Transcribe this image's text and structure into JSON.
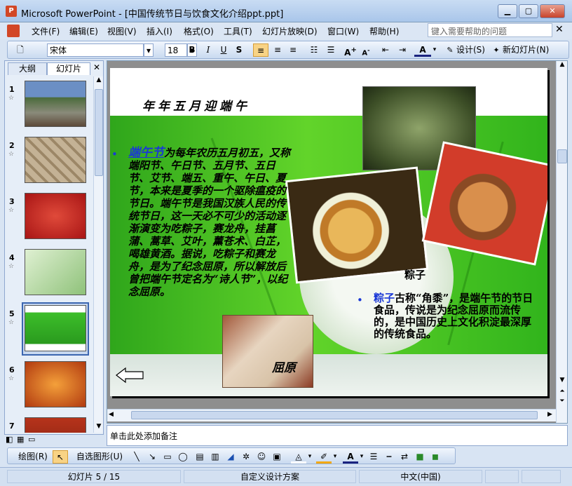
{
  "window": {
    "title": "Microsoft PowerPoint - [中国传统节日与饮食文化介绍ppt.ppt]",
    "app_icon": "P"
  },
  "menu": {
    "items": [
      "文件(F)",
      "编辑(E)",
      "视图(V)",
      "插入(I)",
      "格式(O)",
      "工具(T)",
      "幻灯片放映(D)",
      "窗口(W)",
      "帮助(H)"
    ],
    "help_placeholder": "键入需要帮助的问题"
  },
  "toolbar": {
    "font": "宋体",
    "size": "18",
    "bold": "B",
    "italic": "I",
    "underline": "U",
    "shadow": "S",
    "design": "设计(S)",
    "new_slide": "新幻灯片(N)"
  },
  "panel": {
    "tab_outline": "大纲",
    "tab_slides": "幻灯片",
    "thumbs": [
      {
        "num": "1"
      },
      {
        "num": "2"
      },
      {
        "num": "3"
      },
      {
        "num": "4"
      },
      {
        "num": "5"
      },
      {
        "num": "6"
      },
      {
        "num": "7"
      }
    ],
    "selected": 5
  },
  "slide": {
    "heading": "年年五月迎端午",
    "bullet1_term": "端午节",
    "bullet1_text": "为每年农历五月初五，又称端阳节、午日节、五月节、五日节、艾节、端五、重午、午日、夏节，本来是夏季的一个驱除瘟疫的节日。端午节是我国汉族人民的传统节日，这一天必不可少的活动逐渐演变为吃粽子，赛龙舟，挂菖蒲、蒿草、艾叶，薰苍术、白芷，喝雄黄酒。据说，吃粽子和赛龙舟，是为了纪念屈原，所以解放后曾把端午节定名为“诗人节”，以纪念屈原。",
    "caption": "粽子",
    "bullet2_term": "粽子",
    "bullet2_text": "古称“角黍”，是端午节的节日食品，传说是为纪念屈原而流传的，是中国历史上文化积淀最深厚的传统食品。",
    "painting_label": "屈原"
  },
  "notes": {
    "placeholder": "单击此处添加备注"
  },
  "drawbar": {
    "draw": "绘图(R)",
    "autoshapes": "自选图形(U)"
  },
  "status": {
    "slide": "幻灯片 5 / 15",
    "design": "自定义设计方案",
    "lang": "中文(中国)"
  }
}
